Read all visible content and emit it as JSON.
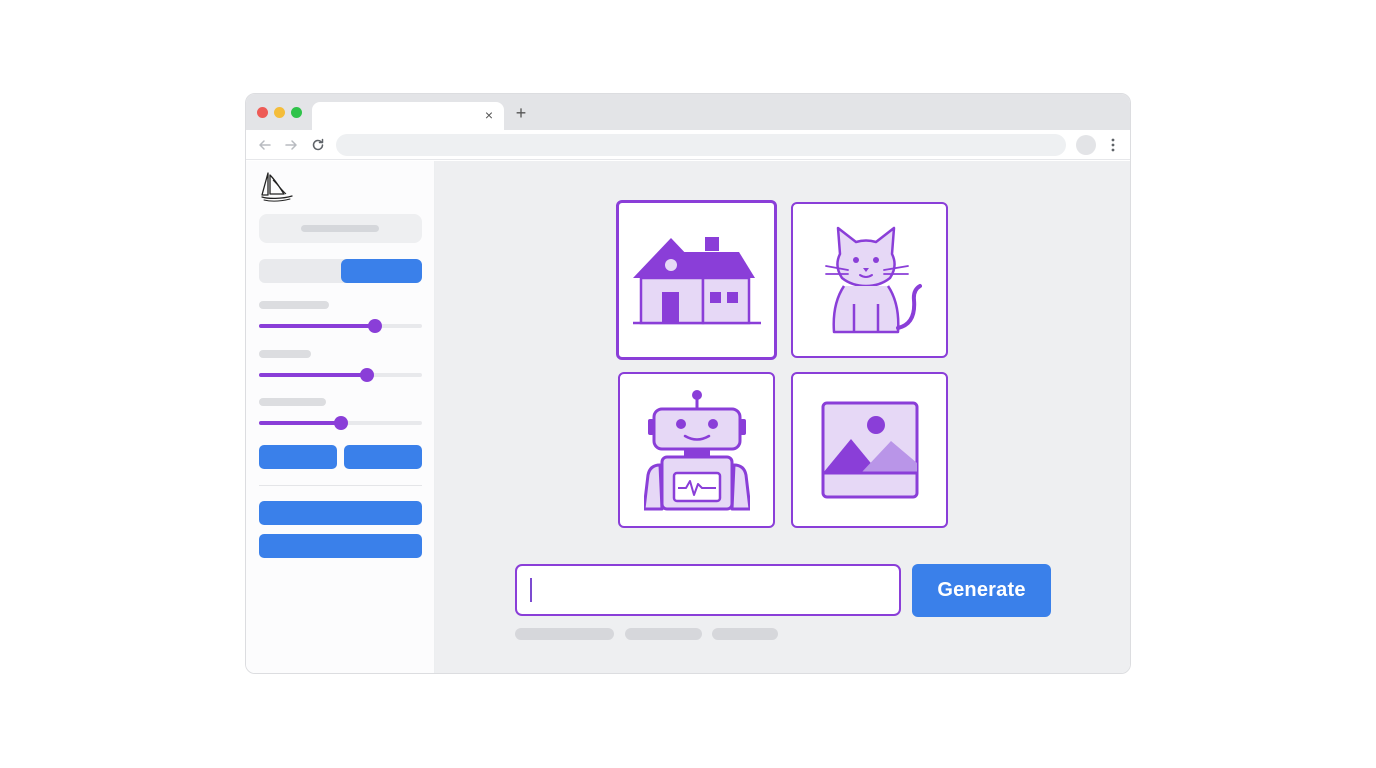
{
  "window": {
    "tab_close_icon": "×",
    "new_tab_icon": "+"
  },
  "toolbar": {
    "back_icon": "arrow-left-icon",
    "forward_icon": "arrow-right-icon",
    "reload_icon": "reload-icon",
    "menu_icon": "more-vertical-icon"
  },
  "sidebar": {
    "logo_icon": "sailboat-logo-icon",
    "toggle_selected": "right",
    "sliders": [
      {
        "value": 0.71
      },
      {
        "value": 0.66
      },
      {
        "value": 0.5
      }
    ]
  },
  "grid": {
    "images": [
      {
        "icon": "house-icon",
        "selected": true
      },
      {
        "icon": "cat-icon",
        "selected": false
      },
      {
        "icon": "robot-icon",
        "selected": false
      },
      {
        "icon": "landscape-image-icon",
        "selected": false
      }
    ]
  },
  "prompt": {
    "value": "",
    "generate_label": "Generate"
  },
  "colors": {
    "accent_purple": "#8a3ed8",
    "primary_blue": "#3a80ea"
  }
}
